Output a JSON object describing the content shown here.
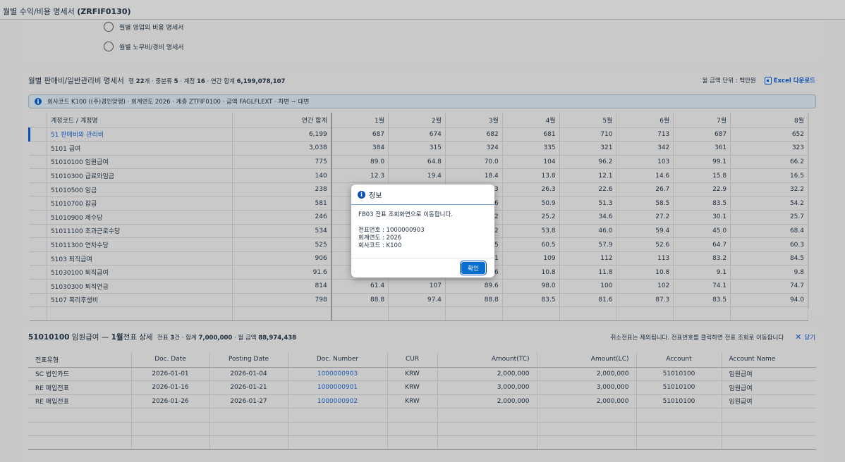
{
  "title": {
    "prefix": "월별 수익/비용 명세서",
    "code": "(ZRFIF0130)"
  },
  "radios": [
    {
      "label": "월별 영업외 비용 명세서"
    },
    {
      "label": "월별 노무비/경비 명세서"
    }
  ],
  "summary": {
    "title": "월별 판매비/일반관리비 명세서",
    "meta_prefix": "행",
    "rows_count": "22",
    "meta_mid1": "개 · 중분류",
    "mid_count": "5",
    "meta_mid2": "· 계정",
    "account_count": "16",
    "meta_mid3": "· 연간 합계",
    "annual_total": "6,199,078,107",
    "unit_label": "월 금액 단위 : 백만원",
    "excel_label": "Excel 다운로드",
    "info_text": "회사코드 K100 ((주)경인양행) · 회계연도 2026 · 계층 ZTFIF0100 · 금액 FAGLFLEXT · 차변 − 대변",
    "columns": [
      "계정코드 / 계정명",
      "연간 합계",
      "1월",
      "2월",
      "3월",
      "4월",
      "5월",
      "6월",
      "7월",
      "8월"
    ],
    "rows": [
      {
        "name": "51 판매비와 관리비",
        "link": true,
        "active": true,
        "vals": [
          "6,199",
          "687",
          "674",
          "682",
          "681",
          "710",
          "713",
          "687",
          "652"
        ]
      },
      {
        "name": "5101 급여",
        "vals": [
          "3,038",
          "384",
          "315",
          "324",
          "335",
          "321",
          "342",
          "361",
          "323"
        ]
      },
      {
        "name": "51010100 임원급여",
        "vals": [
          "775",
          "89.0",
          "64.8",
          "70.0",
          "104",
          "96.2",
          "103",
          "99.1",
          "66.2"
        ]
      },
      {
        "name": "51010300 급료와임금",
        "vals": [
          "140",
          "12.3",
          "19.4",
          "18.4",
          "13.8",
          "12.1",
          "14.6",
          "15.8",
          "16.5"
        ]
      },
      {
        "name": "51010500 임금",
        "vals": [
          "238",
          "",
          "",
          "3",
          "26.3",
          "22.6",
          "26.7",
          "22.9",
          "32.2"
        ]
      },
      {
        "name": "51010700 잡급",
        "vals": [
          "581",
          "",
          "",
          "6",
          "50.9",
          "51.3",
          "58.5",
          "83.5",
          "54.2"
        ]
      },
      {
        "name": "51010900 제수당",
        "vals": [
          "246",
          "",
          "",
          "2",
          "25.2",
          "34.6",
          "27.2",
          "30.1",
          "25.7"
        ]
      },
      {
        "name": "51011100 초과근로수당",
        "vals": [
          "534",
          "",
          "",
          "2",
          "53.8",
          "46.0",
          "59.4",
          "45.0",
          "68.4"
        ]
      },
      {
        "name": "51011300 연차수당",
        "vals": [
          "525",
          "",
          "",
          "5",
          "60.5",
          "57.9",
          "52.6",
          "64.7",
          "60.3"
        ]
      },
      {
        "name": "5103 퇴직급여",
        "vals": [
          "906",
          "",
          "",
          "1",
          "109",
          "112",
          "113",
          "83.2",
          "84.5"
        ]
      },
      {
        "name": "51030100 퇴직급여",
        "vals": [
          "91.6",
          "",
          "",
          "6",
          "10.8",
          "11.8",
          "10.8",
          "9.1",
          "9.8"
        ]
      },
      {
        "name": "51030300 퇴직연금",
        "vals": [
          "814",
          "61.4",
          "107",
          "89.6",
          "98.0",
          "100",
          "102",
          "74.1",
          "74.7"
        ]
      },
      {
        "name": "5107 복리후생비",
        "vals": [
          "798",
          "88.8",
          "97.4",
          "88.8",
          "83.5",
          "81.6",
          "87.3",
          "83.5",
          "94.0"
        ]
      }
    ]
  },
  "detail": {
    "account": "51010100",
    "account_name": "임원급여 —",
    "month": "1월",
    "heading_suffix": "전표 상세",
    "meta_prefix": "전표",
    "doc_count": "3",
    "meta_mid": "건 · 합계",
    "total": "7,000,000",
    "meta_mid2": "· 월 금액",
    "month_amount": "88,974,438",
    "note": "취소전표는 제외됩니다. 전표번호를 클릭하면 전표 조회로 이동합니다",
    "close_label": "닫기",
    "columns": [
      "전표유형",
      "Doc. Date",
      "Posting Date",
      "Doc. Number",
      "CUR",
      "Amount(TC)",
      "Amount(LC)",
      "Account",
      "Account Name"
    ],
    "rows": [
      {
        "type": "SC 법인카드",
        "doc_date": "2026-01-01",
        "post_date": "2026-01-04",
        "doc_no": "1000000903",
        "cur": "KRW",
        "tc": "2,000,000",
        "lc": "2,000,000",
        "account": "51010100",
        "acc_name": "임원급여"
      },
      {
        "type": "RE 매입전표",
        "doc_date": "2026-01-16",
        "post_date": "2026-01-21",
        "doc_no": "1000000901",
        "cur": "KRW",
        "tc": "3,000,000",
        "lc": "3,000,000",
        "account": "51010100",
        "acc_name": "임원급여"
      },
      {
        "type": "RE 매입전표",
        "doc_date": "2026-01-26",
        "post_date": "2026-01-27",
        "doc_no": "1000000902",
        "cur": "KRW",
        "tc": "2,000,000",
        "lc": "2,000,000",
        "account": "51010100",
        "acc_name": "임원급여"
      }
    ]
  },
  "dialog": {
    "title": "정보",
    "message": "FB03 전표 조회화면으로 이동합니다.",
    "line1": "전표번호 : 1000000903",
    "line2": "회계연도 : 2026",
    "line3": "회사코드 : K100",
    "ok_label": "확인"
  }
}
